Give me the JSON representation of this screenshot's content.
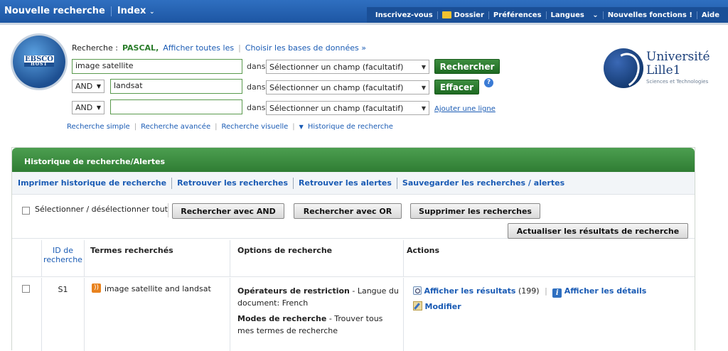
{
  "topnav": {
    "new_search": "Nouvelle recherche",
    "index": "Index",
    "right": [
      "Inscrivez-vous",
      "Dossier",
      "Préférences",
      "Langues",
      "Nouvelles fonctions !",
      "Aide"
    ]
  },
  "logo": {
    "line1": "EBSCO",
    "line2": "HOST"
  },
  "search": {
    "label": "Recherche :",
    "database": "PASCAL,",
    "show_all": "Afficher toutes les",
    "choose_db": "Choisir les bases de données »",
    "rows": [
      {
        "operator": "",
        "value": "image satellite",
        "field": "Sélectionner un champ (facultatif)"
      },
      {
        "operator": "AND",
        "value": "landsat",
        "field": "Sélectionner un champ (facultatif)"
      },
      {
        "operator": "AND",
        "value": "",
        "field": "Sélectionner un champ (facultatif)"
      }
    ],
    "dans": "dans",
    "search_button": "Rechercher",
    "clear_button": "Effacer",
    "add_line": "Ajouter une ligne",
    "modes": [
      "Recherche simple",
      "Recherche avancée",
      "Recherche visuelle",
      "Historique de recherche"
    ]
  },
  "university": {
    "name1": "Université",
    "name2": "Lille1",
    "subtitle": "Sciences et Technologies"
  },
  "history": {
    "title": "Historique de recherche/Alertes",
    "links": [
      "Imprimer historique de recherche",
      "Retrouver les recherches",
      "Retrouver les alertes",
      "Sauvegarder les recherches / alertes"
    ],
    "select_all": "Sélectionner / désélectionner tout",
    "btn_and": "Rechercher avec AND",
    "btn_or": "Rechercher avec OR",
    "btn_delete": "Supprimer les recherches",
    "btn_refresh": "Actualiser les résultats de recherche",
    "columns": {
      "id": "ID de recherche",
      "terms": "Termes recherchés",
      "options": "Options de recherche",
      "actions": "Actions"
    },
    "row": {
      "id": "S1",
      "terms": "image satellite and landsat",
      "opt1_label": "Opérateurs de restriction",
      "opt1_value": " - Langue du document: French",
      "opt2_label": "Modes de recherche",
      "opt2_value": " - Trouver tous mes termes de recherche",
      "show_results": "Afficher les résultats",
      "count": "(199)",
      "show_details": "Afficher les détails",
      "modify": "Modifier"
    }
  }
}
